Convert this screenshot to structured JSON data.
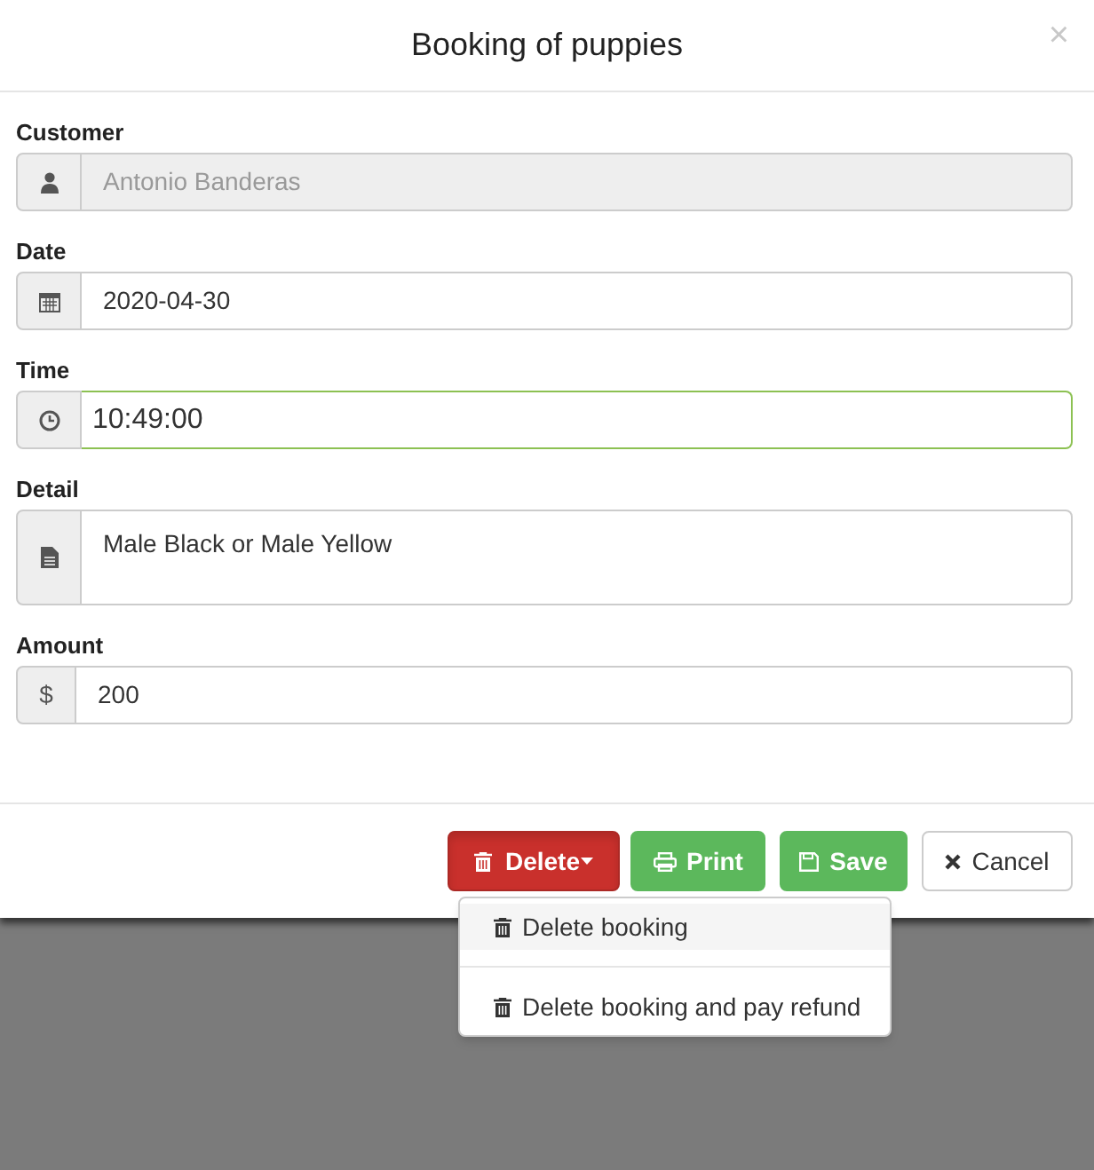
{
  "dialog": {
    "title": "Booking of puppies",
    "close": "×"
  },
  "fields": [
    {
      "label": "Customer",
      "kind": "user",
      "value": "Antonio Banderas",
      "disabled": true,
      "focused": false
    },
    {
      "label": "Date",
      "kind": "calendar",
      "value": "2020-04-30",
      "disabled": false,
      "focused": false
    },
    {
      "label": "Time",
      "kind": "clock",
      "value": "10:49:00",
      "disabled": false,
      "focused": true
    },
    {
      "label": "Detail",
      "kind": "note",
      "value": "Male Black or Male Yellow",
      "disabled": false,
      "focused": false
    },
    {
      "label": "Amount",
      "kind": "currency",
      "addon": "$",
      "value": "200",
      "disabled": false,
      "focused": false
    }
  ],
  "buttons": [
    {
      "label": "Delete",
      "kind": "delete",
      "expanded": true
    },
    {
      "label": "Print",
      "kind": "print"
    },
    {
      "label": "Save",
      "kind": "save"
    },
    {
      "label": "Cancel",
      "kind": "cancel"
    }
  ],
  "menu": [
    {
      "label": "Delete booking",
      "selected": true
    },
    {
      "label": "Delete booking and pay refund",
      "selected": false
    }
  ]
}
